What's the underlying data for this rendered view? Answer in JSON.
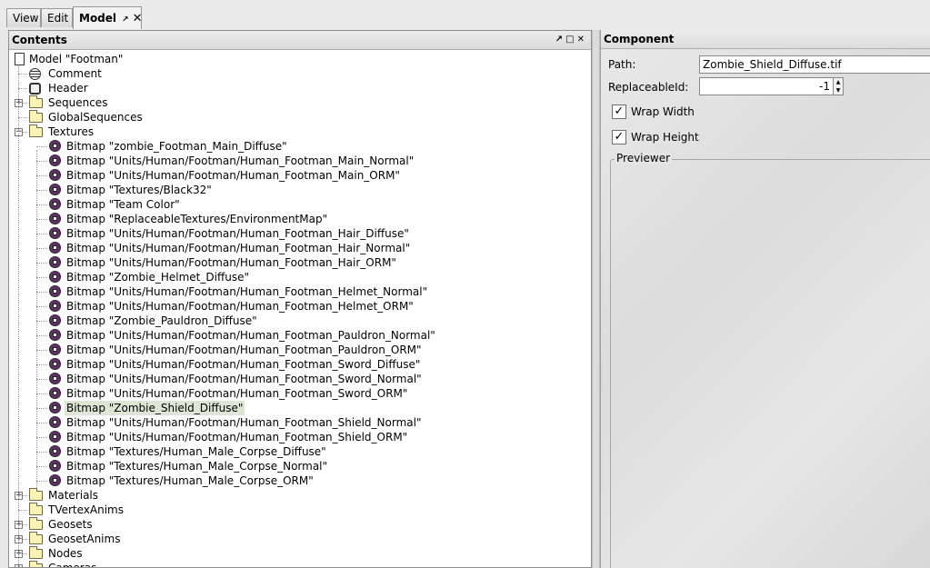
{
  "tabs": [
    {
      "label": "View"
    },
    {
      "label": "Edit"
    },
    {
      "label": "Model",
      "pin_icon": "pin-icon",
      "close_icon": "close-icon"
    }
  ],
  "left_panel": {
    "title": "Contents",
    "header_icons": [
      "restore-icon",
      "maximize-icon",
      "close-icon"
    ],
    "tree": [
      {
        "label": "Model \"Footman\"",
        "icon": "document-icon"
      },
      {
        "label": "Comment",
        "icon": "comment-icon"
      },
      {
        "label": "Header",
        "icon": "header-icon"
      },
      {
        "label": "Sequences",
        "icon": "folder-icon",
        "expander": "+"
      },
      {
        "label": "GlobalSequences",
        "icon": "folder-icon"
      },
      {
        "label": "Textures",
        "icon": "folder-icon",
        "expander": "-"
      },
      {
        "label": "Bitmap \"zombie_Footman_Main_Diffuse\"",
        "icon": "bitmap-icon"
      },
      {
        "label": "Bitmap \"Units/Human/Footman/Human_Footman_Main_Normal\"",
        "icon": "bitmap-icon"
      },
      {
        "label": "Bitmap \"Units/Human/Footman/Human_Footman_Main_ORM\"",
        "icon": "bitmap-icon"
      },
      {
        "label": "Bitmap \"Textures/Black32\"",
        "icon": "bitmap-icon"
      },
      {
        "label": "Bitmap \"Team Color\"",
        "icon": "bitmap-icon"
      },
      {
        "label": "Bitmap \"ReplaceableTextures/EnvironmentMap\"",
        "icon": "bitmap-icon"
      },
      {
        "label": "Bitmap \"Units/Human/Footman/Human_Footman_Hair_Diffuse\"",
        "icon": "bitmap-icon"
      },
      {
        "label": "Bitmap \"Units/Human/Footman/Human_Footman_Hair_Normal\"",
        "icon": "bitmap-icon"
      },
      {
        "label": "Bitmap \"Units/Human/Footman/Human_Footman_Hair_ORM\"",
        "icon": "bitmap-icon"
      },
      {
        "label": "Bitmap \"Zombie_Helmet_Diffuse\"",
        "icon": "bitmap-icon"
      },
      {
        "label": "Bitmap \"Units/Human/Footman/Human_Footman_Helmet_Normal\"",
        "icon": "bitmap-icon"
      },
      {
        "label": "Bitmap \"Units/Human/Footman/Human_Footman_Helmet_ORM\"",
        "icon": "bitmap-icon"
      },
      {
        "label": "Bitmap \"Zombie_Pauldron_Diffuse\"",
        "icon": "bitmap-icon"
      },
      {
        "label": "Bitmap \"Units/Human/Footman/Human_Footman_Pauldron_Normal\"",
        "icon": "bitmap-icon"
      },
      {
        "label": "Bitmap \"Units/Human/Footman/Human_Footman_Pauldron_ORM\"",
        "icon": "bitmap-icon"
      },
      {
        "label": "Bitmap \"Units/Human/Footman/Human_Footman_Sword_Diffuse\"",
        "icon": "bitmap-icon"
      },
      {
        "label": "Bitmap \"Units/Human/Footman/Human_Footman_Sword_Normal\"",
        "icon": "bitmap-icon"
      },
      {
        "label": "Bitmap \"Units/Human/Footman/Human_Footman_Sword_ORM\"",
        "icon": "bitmap-icon"
      },
      {
        "label": "Bitmap \"Zombie_Shield_Diffuse\"",
        "icon": "bitmap-icon",
        "selected": true
      },
      {
        "label": "Bitmap \"Units/Human/Footman/Human_Footman_Shield_Normal\"",
        "icon": "bitmap-icon"
      },
      {
        "label": "Bitmap \"Units/Human/Footman/Human_Footman_Shield_ORM\"",
        "icon": "bitmap-icon"
      },
      {
        "label": "Bitmap \"Textures/Human_Male_Corpse_Diffuse\"",
        "icon": "bitmap-icon"
      },
      {
        "label": "Bitmap \"Textures/Human_Male_Corpse_Normal\"",
        "icon": "bitmap-icon"
      },
      {
        "label": "Bitmap \"Textures/Human_Male_Corpse_ORM\"",
        "icon": "bitmap-icon"
      },
      {
        "label": "Materials",
        "icon": "folder-icon",
        "expander": "+"
      },
      {
        "label": "TVertexAnims",
        "icon": "folder-icon"
      },
      {
        "label": "Geosets",
        "icon": "folder-icon",
        "expander": "+"
      },
      {
        "label": "GeosetAnims",
        "icon": "folder-icon",
        "expander": "+"
      },
      {
        "label": "Nodes",
        "icon": "folder-icon",
        "expander": "+"
      },
      {
        "label": "Cameras",
        "icon": "folder-icon",
        "expander": "+"
      }
    ]
  },
  "right_panel": {
    "title": "Component",
    "path_label": "Path:",
    "path_value": "Zombie_Shield_Diffuse.tif",
    "replaceable_label": "ReplaceableId:",
    "replaceable_value": "-1",
    "wrap_width_label": "Wrap Width",
    "wrap_width_checked": true,
    "wrap_height_label": "Wrap Height",
    "wrap_height_checked": true,
    "previewer_label": "Previewer"
  }
}
